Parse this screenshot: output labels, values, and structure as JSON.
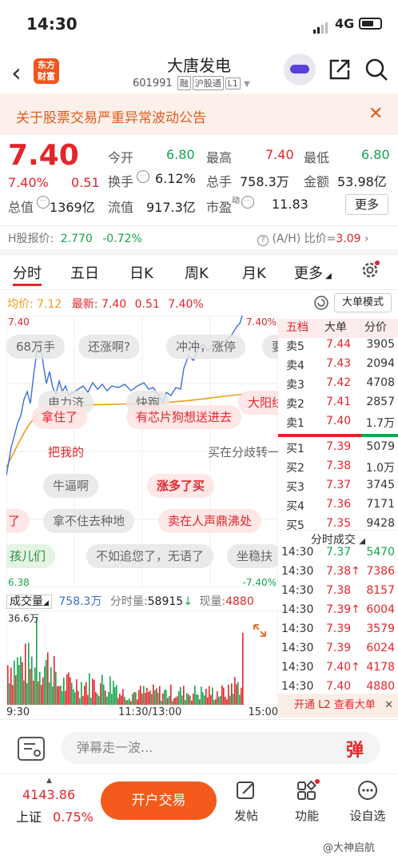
{
  "status": {
    "time": "14:30",
    "network": "4G"
  },
  "header": {
    "stock_name": "大唐发电",
    "code": "601991",
    "tags": [
      "融",
      "沪股通",
      "L1"
    ],
    "logo": "东方\n财富"
  },
  "notice": {
    "text": "关于股票交易严重异常波动公告"
  },
  "quote": {
    "price": "7.40",
    "pct": "7.40%",
    "change": "0.51",
    "open_label": "今开",
    "open": "6.80",
    "high_label": "最高",
    "high": "7.40",
    "low_label": "最低",
    "low": "6.80",
    "turnover_label": "换手",
    "turnover": "6.12%",
    "volume_label": "总手",
    "volume": "758.3万",
    "amount_label": "金额",
    "amount": "53.98亿",
    "mcap_label": "总值",
    "mcap": "1369亿",
    "float_label": "流值",
    "float": "917.3亿",
    "pe_label": "市盈",
    "pe_sup": "动",
    "pe": "11.83",
    "more": "更多"
  },
  "hshare": {
    "label": "H股报价:",
    "price": "2.770",
    "pct": "-0.72%",
    "ah_label": "(A/H) 比价=",
    "ah": "3.09"
  },
  "tabs": [
    "分时",
    "五日",
    "日K",
    "周K",
    "月K",
    "更多"
  ],
  "chart_header": {
    "avg_label": "均价:",
    "avg": "7.12",
    "latest_label": "最新:",
    "latest": "7.40",
    "chg": "0.51",
    "pct": "7.40%",
    "big_order": "大单模式"
  },
  "chart_labels": {
    "top_left": "7.40",
    "top_right": "7.40%",
    "bottom_left": "6.38",
    "bottom_right": "-7.40%"
  },
  "danmaku": [
    "68万手",
    "还涨啊?",
    "冲冲，涨停",
    "要",
    "电力济",
    "快跑",
    "大阳线",
    "拿住了",
    "有芯片狗想送进去",
    "把我的",
    "买在分歧转一",
    "牛逼啊",
    "涨多了买",
    "了",
    "拿不住去种地",
    "卖在人声鼎沸处",
    "孩儿们",
    "不如追您了，无语了",
    "坐稳扶"
  ],
  "book": {
    "headers": [
      "五档",
      "大单",
      "分价"
    ],
    "asks": [
      {
        "l": "卖5",
        "p": "7.44",
        "v": "3905"
      },
      {
        "l": "卖4",
        "p": "7.43",
        "v": "2094"
      },
      {
        "l": "卖3",
        "p": "7.42",
        "v": "4708"
      },
      {
        "l": "卖2",
        "p": "7.41",
        "v": "2857"
      },
      {
        "l": "卖1",
        "p": "7.40",
        "v": "1.7万"
      }
    ],
    "bids": [
      {
        "l": "买1",
        "p": "7.39",
        "v": "5079"
      },
      {
        "l": "买2",
        "p": "7.38",
        "v": "1.0万"
      },
      {
        "l": "买3",
        "p": "7.37",
        "v": "3745"
      },
      {
        "l": "买4",
        "p": "7.36",
        "v": "7171"
      },
      {
        "l": "买5",
        "p": "7.35",
        "v": "9428"
      }
    ],
    "trades_title": "分时成交",
    "trades": [
      {
        "t": "14:30",
        "p": "7.37",
        "a": "",
        "v": "5470",
        "c": "green"
      },
      {
        "t": "14:30",
        "p": "7.38",
        "a": "↑",
        "v": "7386",
        "c": "red"
      },
      {
        "t": "14:30",
        "p": "7.38",
        "a": "",
        "v": "8157",
        "c": "red"
      },
      {
        "t": "14:30",
        "p": "7.39",
        "a": "↑",
        "v": "6004",
        "c": "red"
      },
      {
        "t": "14:30",
        "p": "7.39",
        "a": "",
        "v": "3579",
        "c": "red"
      },
      {
        "t": "14:30",
        "p": "7.39",
        "a": "",
        "v": "6024",
        "c": "red"
      },
      {
        "t": "14:30",
        "p": "7.40",
        "a": "↑",
        "v": "4178",
        "c": "red"
      },
      {
        "t": "14:30",
        "p": "7.40",
        "a": "",
        "v": "4880",
        "c": "red"
      }
    ],
    "l2": "开通 L2 查看大单"
  },
  "volume": {
    "label": "成交量",
    "total": "758.3万",
    "tick_label": "分时量:",
    "tick": "58915",
    "cur_label": "现量:",
    "cur": "4880",
    "max": "36.6万"
  },
  "time_axis": [
    "9:30",
    "11:30/13:00",
    "15:00"
  ],
  "dm_input": {
    "placeholder": "弹幕走一波...",
    "btn": "弹"
  },
  "nav": {
    "index_val": "4143.86",
    "index_name": "上证",
    "index_pct": "0.75%",
    "trade": "开户交易",
    "items": [
      "发帖",
      "功能",
      "设自选"
    ]
  },
  "watermark": "@大神启航",
  "colors": {
    "up": "#e4252a",
    "down": "#14a44d",
    "accent": "#f45a1c"
  }
}
